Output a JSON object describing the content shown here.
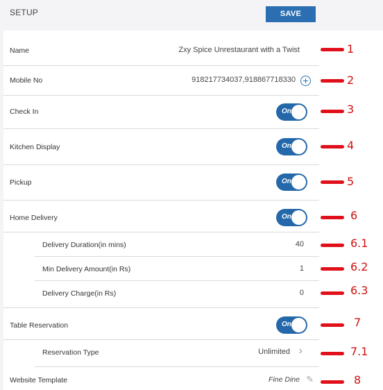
{
  "header": {
    "title": "SETUP",
    "save_label": "SAVE"
  },
  "settings": {
    "name": {
      "label": "Name",
      "value": "Zxy Spice Unrestaurant with a Twist"
    },
    "mobile": {
      "label": "Mobile No",
      "value": "918217734037,918867718330"
    },
    "check_in": {
      "label": "Check In",
      "state": "On"
    },
    "kitchen_display": {
      "label": "Kitchen Display",
      "state": "On"
    },
    "pickup": {
      "label": "Pickup",
      "state": "On"
    },
    "home_delivery": {
      "label": "Home Delivery",
      "state": "On"
    },
    "delivery_duration": {
      "label": "Delivery Duration(in mins)",
      "value": "40"
    },
    "min_delivery_amount": {
      "label": "Min Delivery Amount(in Rs)",
      "value": "1"
    },
    "delivery_charge": {
      "label": "Delivery Charge(in Rs)",
      "value": "0"
    },
    "table_reservation": {
      "label": "Table Reservation",
      "state": "On"
    },
    "reservation_type": {
      "label": "Reservation Type",
      "value": "Unlimited"
    },
    "website_template": {
      "label": "Website Template",
      "value": "Fine Dine"
    }
  },
  "annotations": [
    "1",
    "2",
    "3",
    "4",
    "5",
    "6",
    "6.1",
    "6.2",
    "6.3",
    "7",
    "7.1",
    "8"
  ],
  "colors": {
    "accent": "#2b6fb2",
    "toggle": "#2468aa",
    "annotation": "#e0101a",
    "header_bg": "#f4f4f6"
  }
}
